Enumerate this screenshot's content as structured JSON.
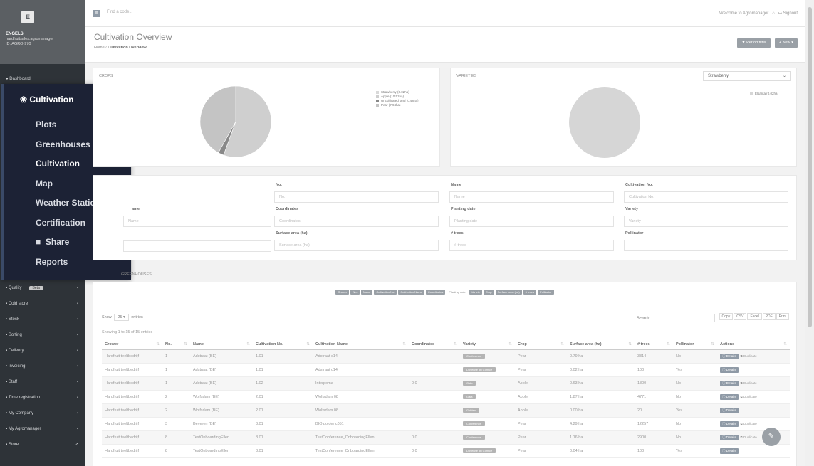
{
  "app": {
    "logo_letter": "E"
  },
  "user": {
    "company": "ENGELS",
    "email": "hardfruitsales.agromanager",
    "id": "ID: AGRO-970"
  },
  "topbar": {
    "search_placeholder": "Find a code...",
    "welcome": "Welcome to Agromanager",
    "signout": "Signout"
  },
  "page": {
    "title": "Cultivation Overview",
    "crumb_home": "Home",
    "crumb_sep": "/",
    "crumb_current": "Cultivation Overview",
    "period_filter": "Period filter",
    "new_button": "New"
  },
  "sidebar": {
    "dashboard": "Dashboard",
    "items": [
      {
        "icon": "quality-icon",
        "label": "Quality",
        "badge": "Beta"
      },
      {
        "icon": "cold-store-icon",
        "label": "Cold store"
      },
      {
        "icon": "stock-icon",
        "label": "Stock"
      },
      {
        "icon": "sorting-icon",
        "label": "Sorting"
      },
      {
        "icon": "delivery-icon",
        "label": "Delivery"
      },
      {
        "icon": "invoicing-icon",
        "label": "Invoicing"
      },
      {
        "icon": "staff-icon",
        "label": "Staff"
      },
      {
        "icon": "time-icon",
        "label": "Time registration"
      },
      {
        "icon": "company-icon",
        "label": "My Company"
      },
      {
        "icon": "agromanager-icon",
        "label": "My Agromanager"
      },
      {
        "icon": "store-icon",
        "label": "Store"
      }
    ]
  },
  "flyout": {
    "header": "Cultivation",
    "items": [
      "Plots",
      "Greenhouses",
      "Cultivation",
      "Map",
      "Weather Station",
      "Certification",
      "Share",
      "Reports"
    ],
    "active": "Cultivation"
  },
  "crops": {
    "title": "CROPS",
    "legend": [
      {
        "label": "Strawberry (0.02ha)",
        "value": 0.02,
        "color": "#d9d9d9"
      },
      {
        "label": "Apple (10.51ha)",
        "value": 10.51,
        "color": "#cfcfcf"
      },
      {
        "label": "Uncultivated land (0.48ha)",
        "value": 0.48,
        "color": "#888888"
      },
      {
        "label": "Pear (7.94ha)",
        "value": 7.94,
        "color": "#c4c4c4"
      }
    ]
  },
  "varieties": {
    "title": "VARIETIES",
    "select_value": "Strawberry",
    "legend": [
      {
        "label": "Elsanta (0.02ha)",
        "value": 0.02,
        "color": "#d6d6d6"
      }
    ]
  },
  "filters": [
    {
      "label": "No.",
      "placeholder": "No."
    },
    {
      "label": "Name",
      "placeholder": "Name"
    },
    {
      "label": "Cultivation No.",
      "placeholder": "Cultivation No."
    },
    {
      "label": "Coordinates",
      "placeholder": "Coordinates"
    },
    {
      "label": "Planting date",
      "placeholder": "Planting date"
    },
    {
      "label": "Variety",
      "placeholder": "Variety"
    },
    {
      "label": "Surface area (ha)",
      "placeholder": "Surface area (ha)"
    },
    {
      "label": "# trees",
      "placeholder": "# trees"
    },
    {
      "label": "Pollinator",
      "placeholder": ""
    }
  ],
  "filters_partial": {
    "name_label_tail": "ame",
    "name_placeholder_tail": "Name"
  },
  "section_title": "GREENHOUSES",
  "column_toggles": [
    "Grower",
    "No.",
    "Name",
    "Cultivation No.",
    "Cultivation Name",
    "Coordinates",
    "Planting date",
    "Variety",
    "Crop",
    "Surface area (ha)",
    "# trees",
    "Pollinator"
  ],
  "table_controls": {
    "show": "Show",
    "entries_value": "25",
    "entries": "entries",
    "search": "Search:",
    "info": "Showing 1 to 15 of 15 entries",
    "exports": [
      "Copy",
      "CSV",
      "Excel",
      "PDF",
      "Print"
    ]
  },
  "table": {
    "headers": [
      "Grower",
      "No.",
      "Name",
      "Cultivation No.",
      "Cultivation Name",
      "Coordinates",
      "Variety",
      "Crop",
      "Surface area (ha)",
      "# trees",
      "Pollinator",
      "Actions"
    ],
    "details_label": "Details",
    "duplicate_label": "Duplicate",
    "rows": [
      [
        "Hardfruit teeltbedrijf",
        "1",
        "Adstraat (BE)",
        "1.01",
        "Adstraat c14",
        "",
        "Conference",
        "Pear",
        "0.79 ha",
        "3314",
        "No",
        "dup"
      ],
      [
        "Hardfruit teeltbedrijf",
        "1",
        "Adstraat (BE)",
        "1.01",
        "Adstraat c14",
        "",
        "Doyenné du Comice",
        "Pear",
        "0.02 ha",
        "100",
        "Yes",
        ""
      ],
      [
        "Hardfruit teeltbedrijf",
        "1",
        "Adstraat (BE)",
        "1.02",
        "Interpoma",
        "0.0",
        "Gala",
        "Apple",
        "0.63 ha",
        "1800",
        "No",
        "dup"
      ],
      [
        "Hardfruit teeltbedrijf",
        "2",
        "Wolfsdam (BE)",
        "2.01",
        "Wolfsdam 08",
        "",
        "Gala",
        "Apple",
        "1.87 ha",
        "4771",
        "No",
        "dup"
      ],
      [
        "Hardfruit teeltbedrijf",
        "2",
        "Wolfsdam (BE)",
        "2.01",
        "Wolfsdam 08",
        "",
        "Golden",
        "Apple",
        "0.00 ha",
        "20",
        "Yes",
        ""
      ],
      [
        "Hardfruit teeltbedrijf",
        "3",
        "Beveren (BE)",
        "3.01",
        "BIO polder c051",
        "",
        "Conference",
        "Pear",
        "4.29 ha",
        "12257",
        "No",
        "dup"
      ],
      [
        "Hardfruit teeltbedrijf",
        "8",
        "TestOnboardingEllen",
        "8.01",
        "TestConference_OnboardingEllen",
        "0.0",
        "Conference",
        "Pear",
        "1.16 ha",
        "2900",
        "No",
        "dup"
      ],
      [
        "Hardfruit teeltbedrijf",
        "8",
        "TestOnboardingEllen",
        "8.01",
        "TestConference_OnboardingEllen",
        "0.0",
        "Doyenné du Comice",
        "Pear",
        "0.04 ha",
        "100",
        "Yes",
        ""
      ]
    ]
  }
}
